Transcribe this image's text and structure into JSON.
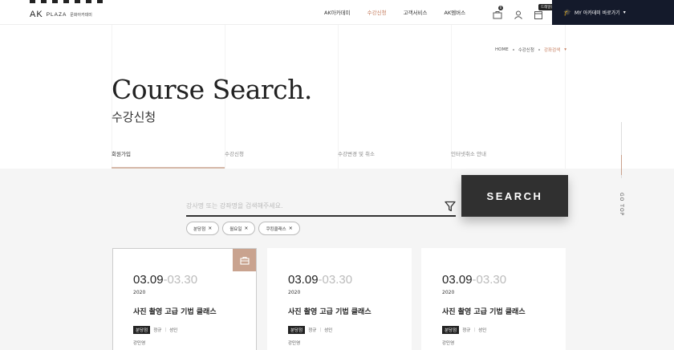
{
  "header": {
    "logo_ak": "AK",
    "logo_plaza": "PLAZA",
    "logo_sub": "문화아카데미",
    "nav": [
      "AK아카데미",
      "수강신청",
      "고객서비스",
      "AK멤버스"
    ],
    "cart_count": "0",
    "tooltip": "드레일링고",
    "my_button": "MY 아카데미 바로가기"
  },
  "breadcrumb": {
    "home": "HOME",
    "level1": "수강신청",
    "current": "강좌검색"
  },
  "hero": {
    "title_en": "Course Search.",
    "title_ko": "수강신청"
  },
  "tabs": [
    "회원가입",
    "수강신청",
    "수강변경 및 취소",
    "인터넷취소 안내"
  ],
  "side": {
    "go_top": "GO TOP"
  },
  "search": {
    "placeholder": "강사명 또는 강좌명을 검색해주세요.",
    "button": "SEARCH",
    "chips": [
      "분당점",
      "월요일",
      "쿠킹클래스"
    ]
  },
  "cards": [
    {
      "start": "03.09",
      "end": "03.30",
      "year": "2020",
      "name": "사진 촬영 고급 기법 클래스",
      "branch": "분당점",
      "type": "정규",
      "target": "성인",
      "teacher": "강민영"
    },
    {
      "start": "03.09",
      "end": "03.30",
      "year": "2020",
      "name": "사진 촬영 고급 기법 클래스",
      "branch": "분당점",
      "type": "정규",
      "target": "성인",
      "teacher": "강민영"
    },
    {
      "start": "03.09",
      "end": "03.30",
      "year": "2020",
      "name": "사진 촬영 고급 기법 클래스",
      "branch": "분당점",
      "type": "정규",
      "target": "성인",
      "teacher": "강민영"
    }
  ],
  "colors": {
    "accent": "#c47b5c",
    "dark": "#303030",
    "navy": "#141a2b",
    "bag": "#c9a38f"
  }
}
